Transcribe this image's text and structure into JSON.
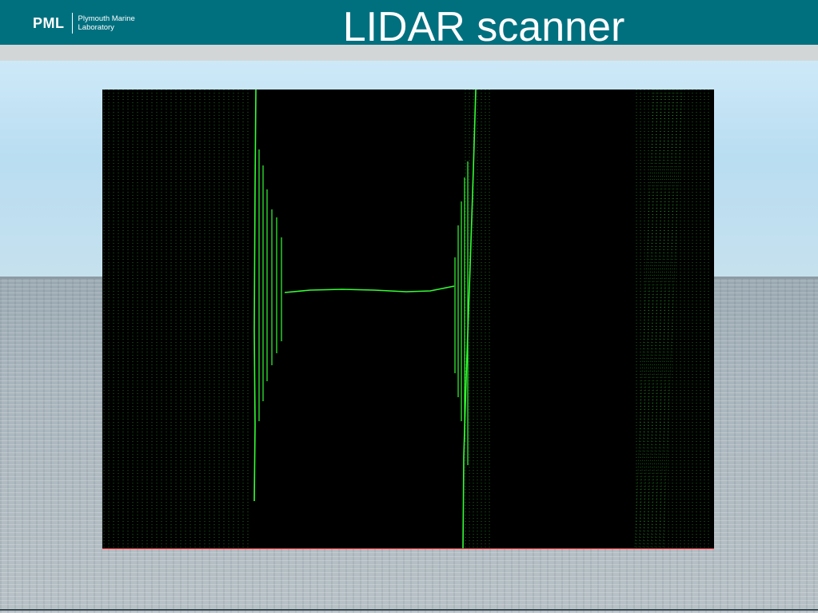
{
  "header": {
    "logo_mark": "PML",
    "logo_line1": "Plymouth Marine",
    "logo_line2": "Laboratory",
    "title": "LIDAR scanner"
  },
  "colors": {
    "header_bg": "#00707f",
    "scan_bg": "#000000",
    "scan_line": "#33ff33"
  }
}
